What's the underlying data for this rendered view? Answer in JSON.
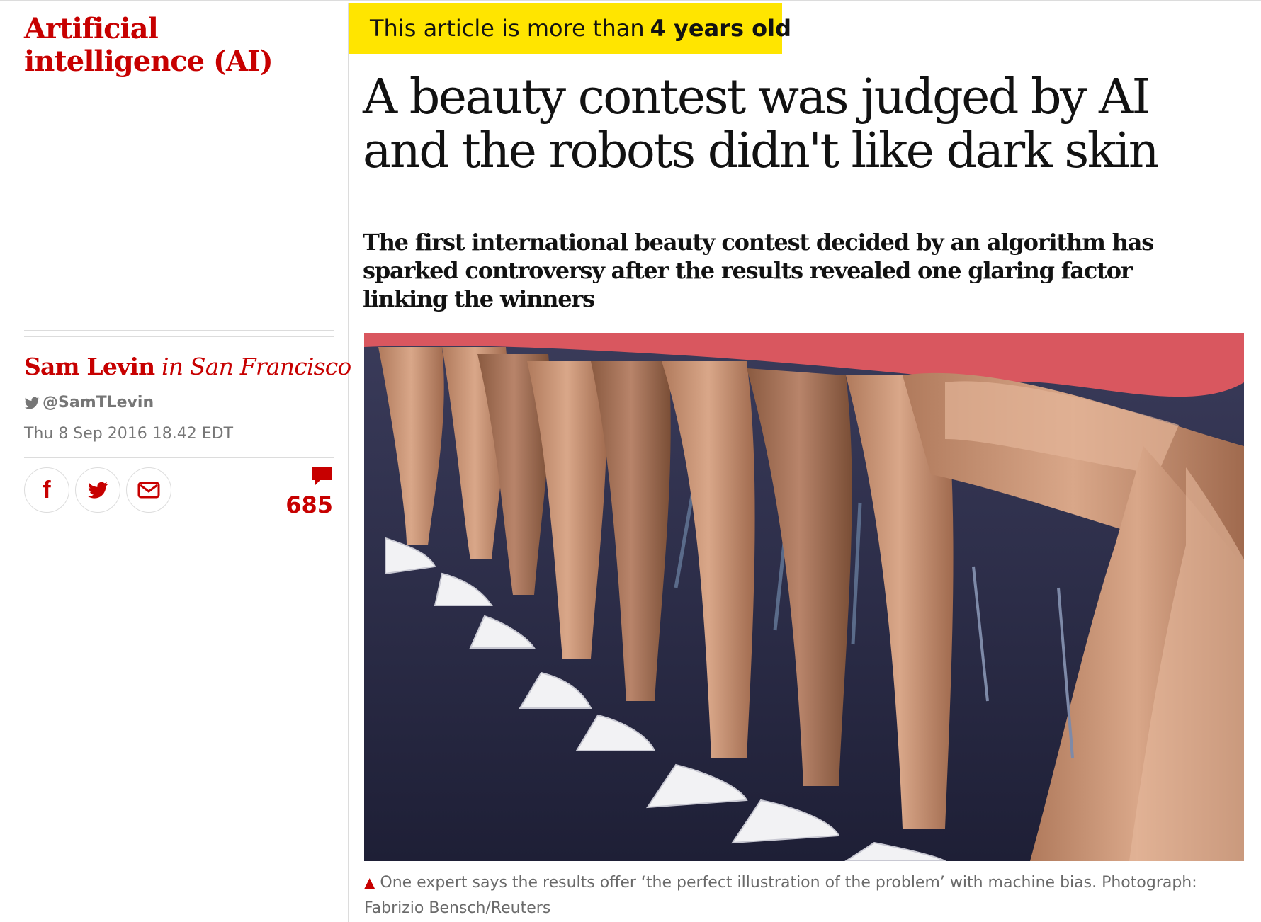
{
  "section": {
    "label": "Artificial intelligence (AI)"
  },
  "byline": {
    "author": "Sam Levin",
    "location": "in San Francisco"
  },
  "twitter": {
    "handle": "@SamTLevin",
    "icon": "twitter-bird-icon"
  },
  "dateline": "Thu 8 Sep 2016 18.42 EDT",
  "share": [
    {
      "name": "facebook-share-button",
      "icon": "facebook-icon"
    },
    {
      "name": "twitter-share-button",
      "icon": "twitter-icon"
    },
    {
      "name": "email-share-button",
      "icon": "email-icon"
    }
  ],
  "comments": {
    "count": "685",
    "icon": "comment-bubble-icon"
  },
  "age_banner": {
    "prefix": "This article is more than",
    "age": "4 years old",
    "icon": "clock-icon",
    "color": "#ffe500"
  },
  "headline": "A beauty contest was judged by AI and the robots didn't like dark skin",
  "standfirst": "The first international beauty contest decided by an algorithm has sparked controversy after the results revealed one glaring factor linking the winners",
  "caption": {
    "text": "One expert says the results offer ‘the perfect illustration of the problem’ with machine bias. Photograph: Fabrizio Bensch/Reuters",
    "icon": "triangle-up-icon"
  },
  "colors": {
    "accent": "#c70000",
    "banner": "#ffe500",
    "text": "#121212",
    "muted": "#767676"
  }
}
